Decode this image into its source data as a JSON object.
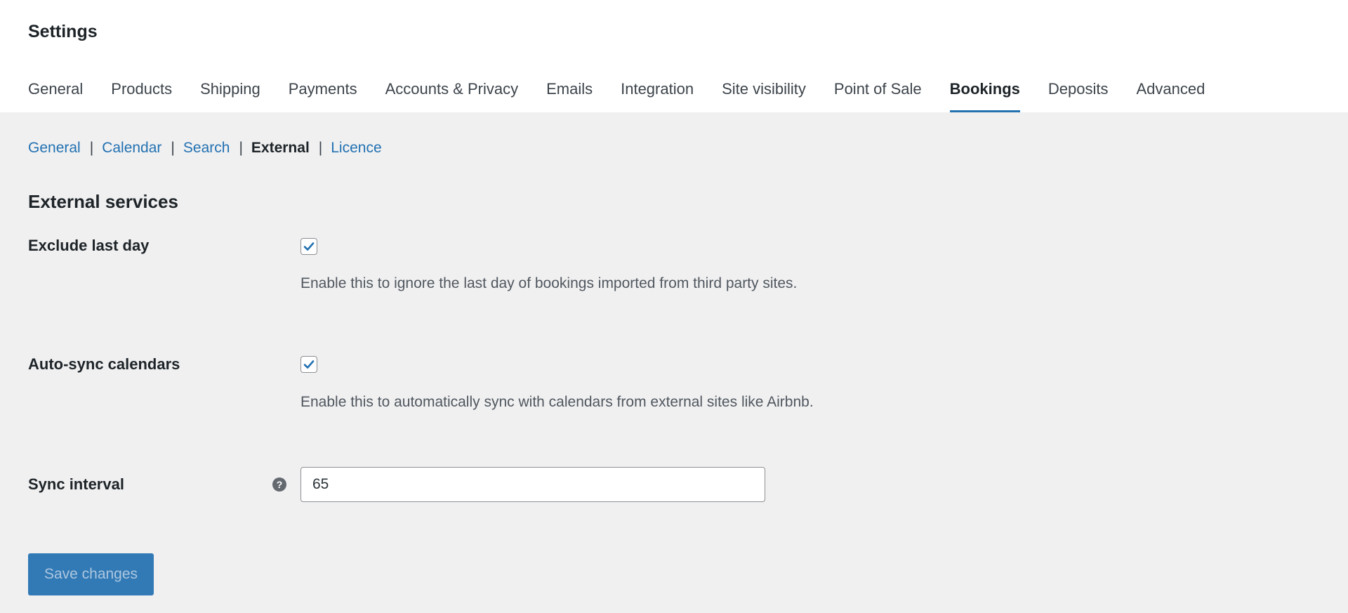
{
  "page": {
    "title": "Settings"
  },
  "tabs": [
    {
      "label": "General"
    },
    {
      "label": "Products"
    },
    {
      "label": "Shipping"
    },
    {
      "label": "Payments"
    },
    {
      "label": "Accounts & Privacy"
    },
    {
      "label": "Emails"
    },
    {
      "label": "Integration"
    },
    {
      "label": "Site visibility"
    },
    {
      "label": "Point of Sale"
    },
    {
      "label": "Bookings",
      "active": true
    },
    {
      "label": "Deposits"
    },
    {
      "label": "Advanced"
    }
  ],
  "subnav": {
    "items": [
      {
        "label": "General"
      },
      {
        "label": "Calendar"
      },
      {
        "label": "Search"
      },
      {
        "label": "External",
        "current": true
      },
      {
        "label": "Licence"
      }
    ],
    "separator": "|"
  },
  "section": {
    "title": "External services"
  },
  "fields": {
    "exclude_last_day": {
      "label": "Exclude last day",
      "checked": true,
      "description": "Enable this to ignore the last day of bookings imported from third party sites."
    },
    "auto_sync": {
      "label": "Auto-sync calendars",
      "checked": true,
      "description": "Enable this to automatically sync with calendars from external sites like Airbnb."
    },
    "sync_interval": {
      "label": "Sync interval",
      "value": "65",
      "help_icon": "question-mark-icon",
      "help_glyph": "?"
    }
  },
  "actions": {
    "save_label": "Save changes"
  },
  "colors": {
    "accent": "#2271b1",
    "background": "#f0f0f1",
    "header_background": "#ffffff",
    "text": "#1d2327",
    "description": "#50575e"
  }
}
